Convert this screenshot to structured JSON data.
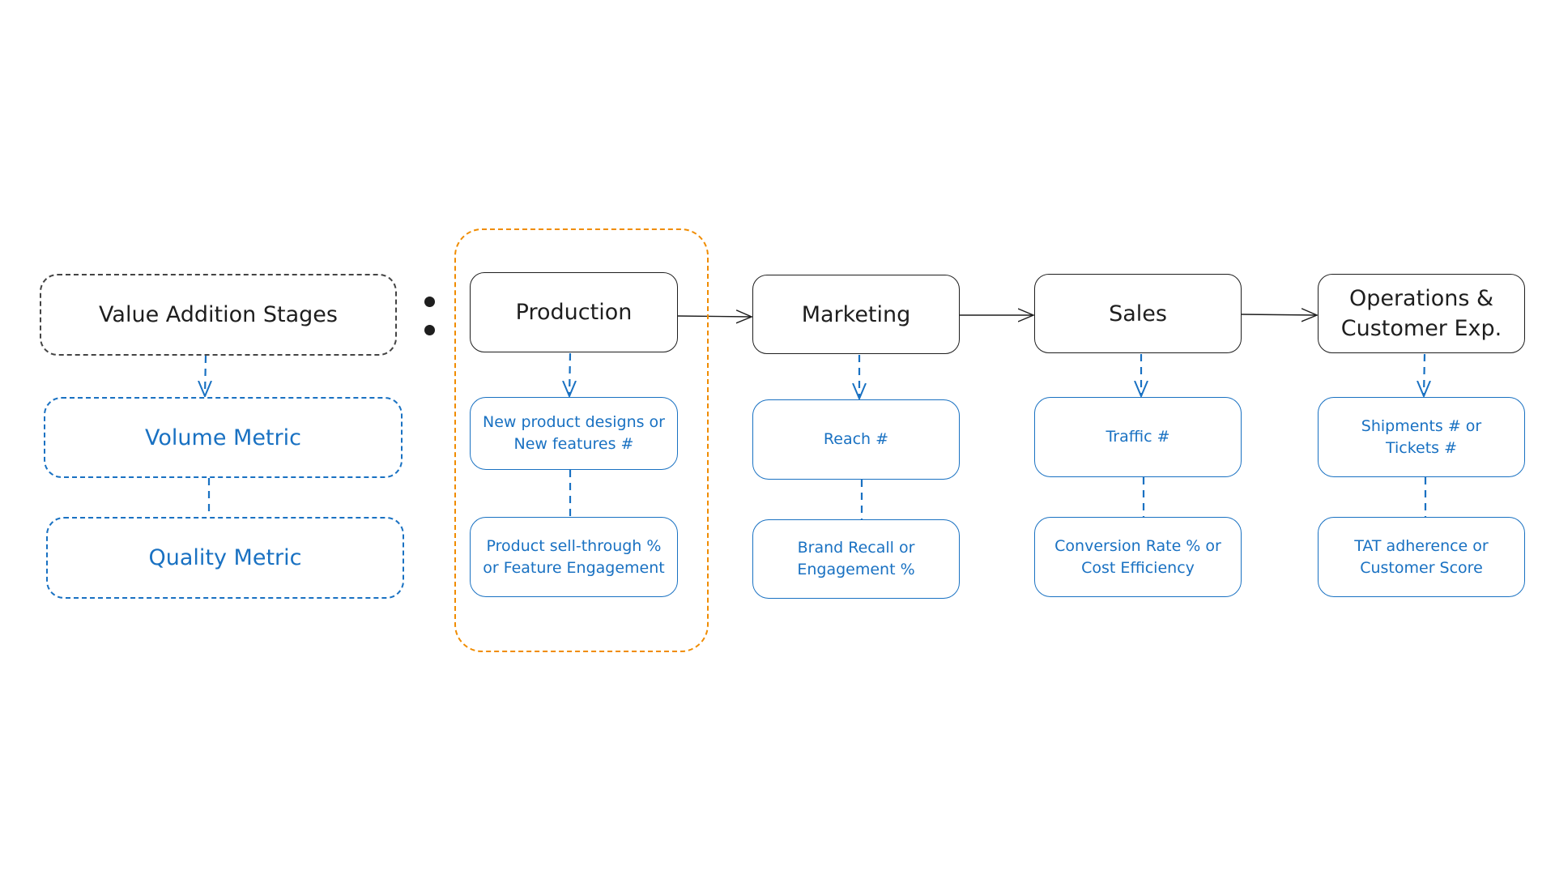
{
  "colors": {
    "stage_stroke": "#1e1e1e",
    "metric_blue": "#1971c2",
    "highlight_orange": "#f08c00",
    "legend_stroke": "#444444"
  },
  "legend": {
    "header": "Value Addition Stages",
    "volume_metric": "Volume Metric",
    "quality_metric": "Quality Metric",
    "separator": ":"
  },
  "highlighted_stage": "Production",
  "stages": [
    {
      "name": "Production",
      "volume_metric": "New product designs or\nNew features #",
      "quality_metric": "Product sell-through %\nor Feature Engagement"
    },
    {
      "name": "Marketing",
      "volume_metric": "Reach #",
      "quality_metric": "Brand Recall or\nEngagement %"
    },
    {
      "name": "Sales",
      "volume_metric": "Traffic #",
      "quality_metric": "Conversion Rate % or\nCost Efficiency"
    },
    {
      "name": "Operations &\nCustomer Exp.",
      "volume_metric": "Shipments # or\nTickets #",
      "quality_metric": "TAT adherence or\nCustomer Score"
    }
  ]
}
